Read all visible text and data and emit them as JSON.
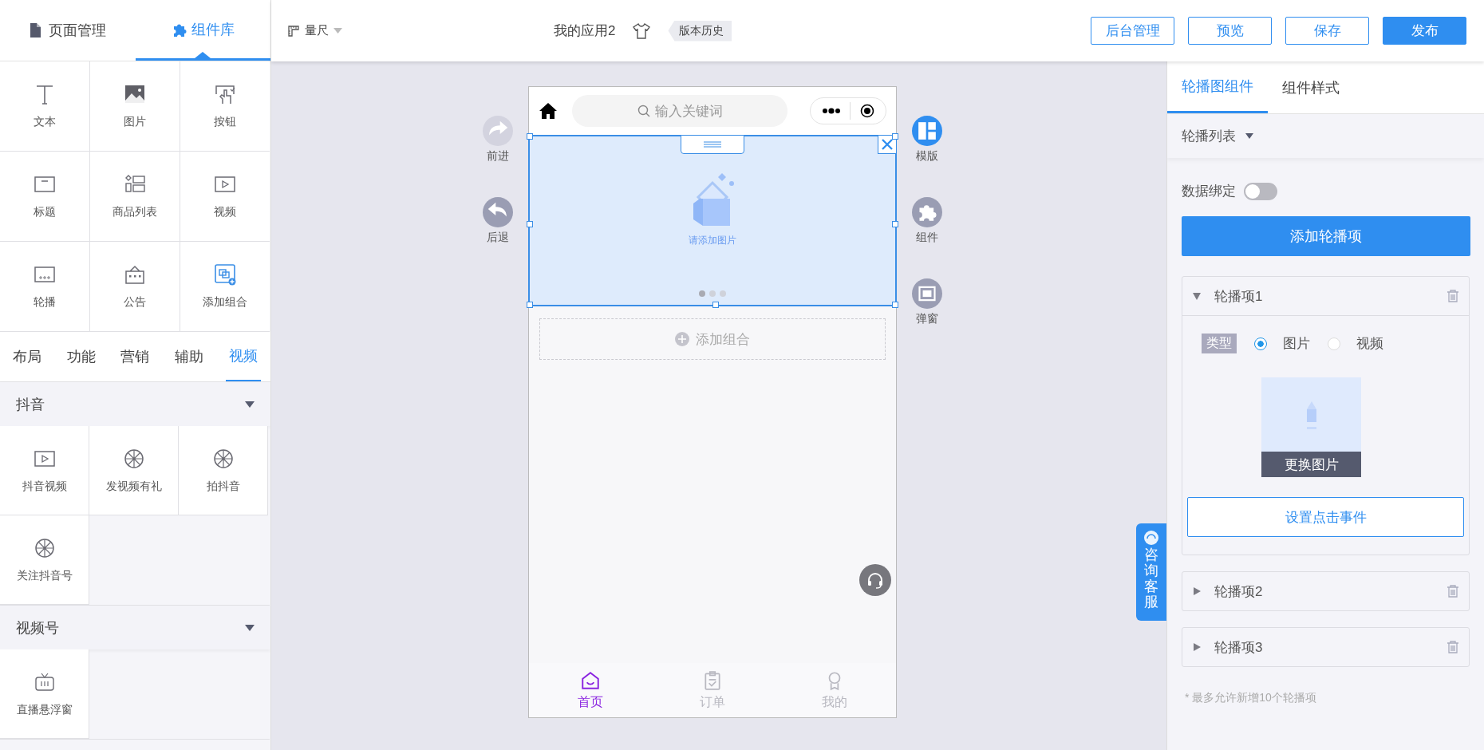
{
  "left_tabs": [
    {
      "label": "页面管理",
      "selected": false
    },
    {
      "label": "组件库",
      "selected": true
    }
  ],
  "basic_components": [
    "文本",
    "图片",
    "按钮",
    "标题",
    "商品列表",
    "视频",
    "轮播",
    "公告",
    "添加组合"
  ],
  "category_tabs": [
    {
      "label": "布局",
      "selected": false
    },
    {
      "label": "功能",
      "selected": false
    },
    {
      "label": "营销",
      "selected": false
    },
    {
      "label": "辅助",
      "selected": false
    },
    {
      "label": "视频",
      "selected": true
    }
  ],
  "groups": [
    {
      "title": "抖音",
      "expanded": true,
      "items": [
        "抖音视频",
        "发视频有礼",
        "拍抖音",
        "关注抖音号"
      ]
    },
    {
      "title": "视频号",
      "expanded": true,
      "items": [
        "直播悬浮窗"
      ]
    }
  ],
  "toolbar": {
    "ruler": "量尺",
    "app_title": "我的应用2",
    "version_history": "版本历史",
    "buttons": [
      {
        "label": "后台管理",
        "primary": false
      },
      {
        "label": "预览",
        "primary": false
      },
      {
        "label": "保存",
        "primary": false
      },
      {
        "label": "发布",
        "primary": true
      }
    ]
  },
  "side_left": [
    {
      "label": "前进",
      "disabled": true
    },
    {
      "label": "后退",
      "disabled": false
    }
  ],
  "side_right": [
    {
      "label": "模版",
      "selected": true
    },
    {
      "label": "组件",
      "selected": false
    },
    {
      "label": "弹窗",
      "selected": false
    }
  ],
  "phone": {
    "search_placeholder": "输入关键词",
    "carousel": {
      "hint": "请添加图片",
      "dots": [
        {
          "selected": true
        },
        {
          "selected": false
        },
        {
          "selected": false
        }
      ]
    },
    "add_group": "添加组合",
    "nav": [
      {
        "label": "首页",
        "selected": true
      },
      {
        "label": "订单",
        "selected": false
      },
      {
        "label": "我的",
        "selected": false
      }
    ]
  },
  "support_tab": "咨询客服",
  "right_panel": {
    "tabs": [
      {
        "label": "轮播图组件",
        "selected": true
      },
      {
        "label": "组件样式",
        "selected": false
      }
    ],
    "section": "轮播列表",
    "data_binding": {
      "label": "数据绑定",
      "on": false
    },
    "add_button": "添加轮播项",
    "items": [
      {
        "title": "轮播项1",
        "expanded": true,
        "type_label": "类型",
        "types": [
          {
            "label": "图片",
            "selected": true
          },
          {
            "label": "视频",
            "selected": false
          }
        ],
        "replace_image": "更换图片",
        "click_event": "设置点击事件"
      },
      {
        "title": "轮播项2",
        "expanded": false
      },
      {
        "title": "轮播项3",
        "expanded": false
      }
    ],
    "note": "* 最多允许新增10个轮播项"
  }
}
